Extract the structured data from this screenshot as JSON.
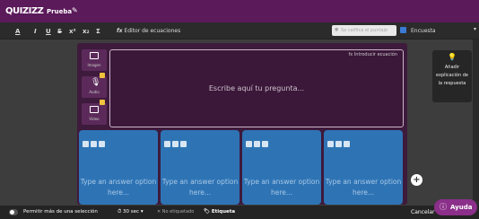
{
  "header": {
    "logo": "QUIZIZZ",
    "quiz_name": "Prueba",
    "edit_icon": "pencil-icon"
  },
  "toolbar": {
    "bold": "A",
    "italic": "I",
    "underline": "U",
    "strike": "S",
    "superscript": "x²",
    "subscript": "x₂",
    "sum": "Σ",
    "equation_editor": "Editor de ecuaciones",
    "disabled_button": "Se califica el puntaje",
    "question_type": "Encuesta"
  },
  "media": {
    "image": "Imagen",
    "audio": "Audio",
    "video": "Video"
  },
  "question": {
    "insert_equation": "Introducir ecuación",
    "placeholder": "Escribe aquí tu pregunta..."
  },
  "answers": [
    {
      "placeholder": "Type an answer option here..."
    },
    {
      "placeholder": "Type an answer option here..."
    },
    {
      "placeholder": "Type an answer option here..."
    },
    {
      "placeholder": "Type an answer option here..."
    }
  ],
  "add_answer": "+",
  "right_panel": {
    "label": "Añadir explicación de la respuesta"
  },
  "footer": {
    "multi_select": "Permitir más de una selección",
    "time": "30 sec",
    "no_tag": "No etiquetado",
    "tag": "Etiqueta",
    "cancel": "Cancelar",
    "help": "Ayuda"
  },
  "colors": {
    "header": "#5b1a5a",
    "answer_card": "#2e74b5",
    "editor_bg": "#3e1a3c"
  }
}
